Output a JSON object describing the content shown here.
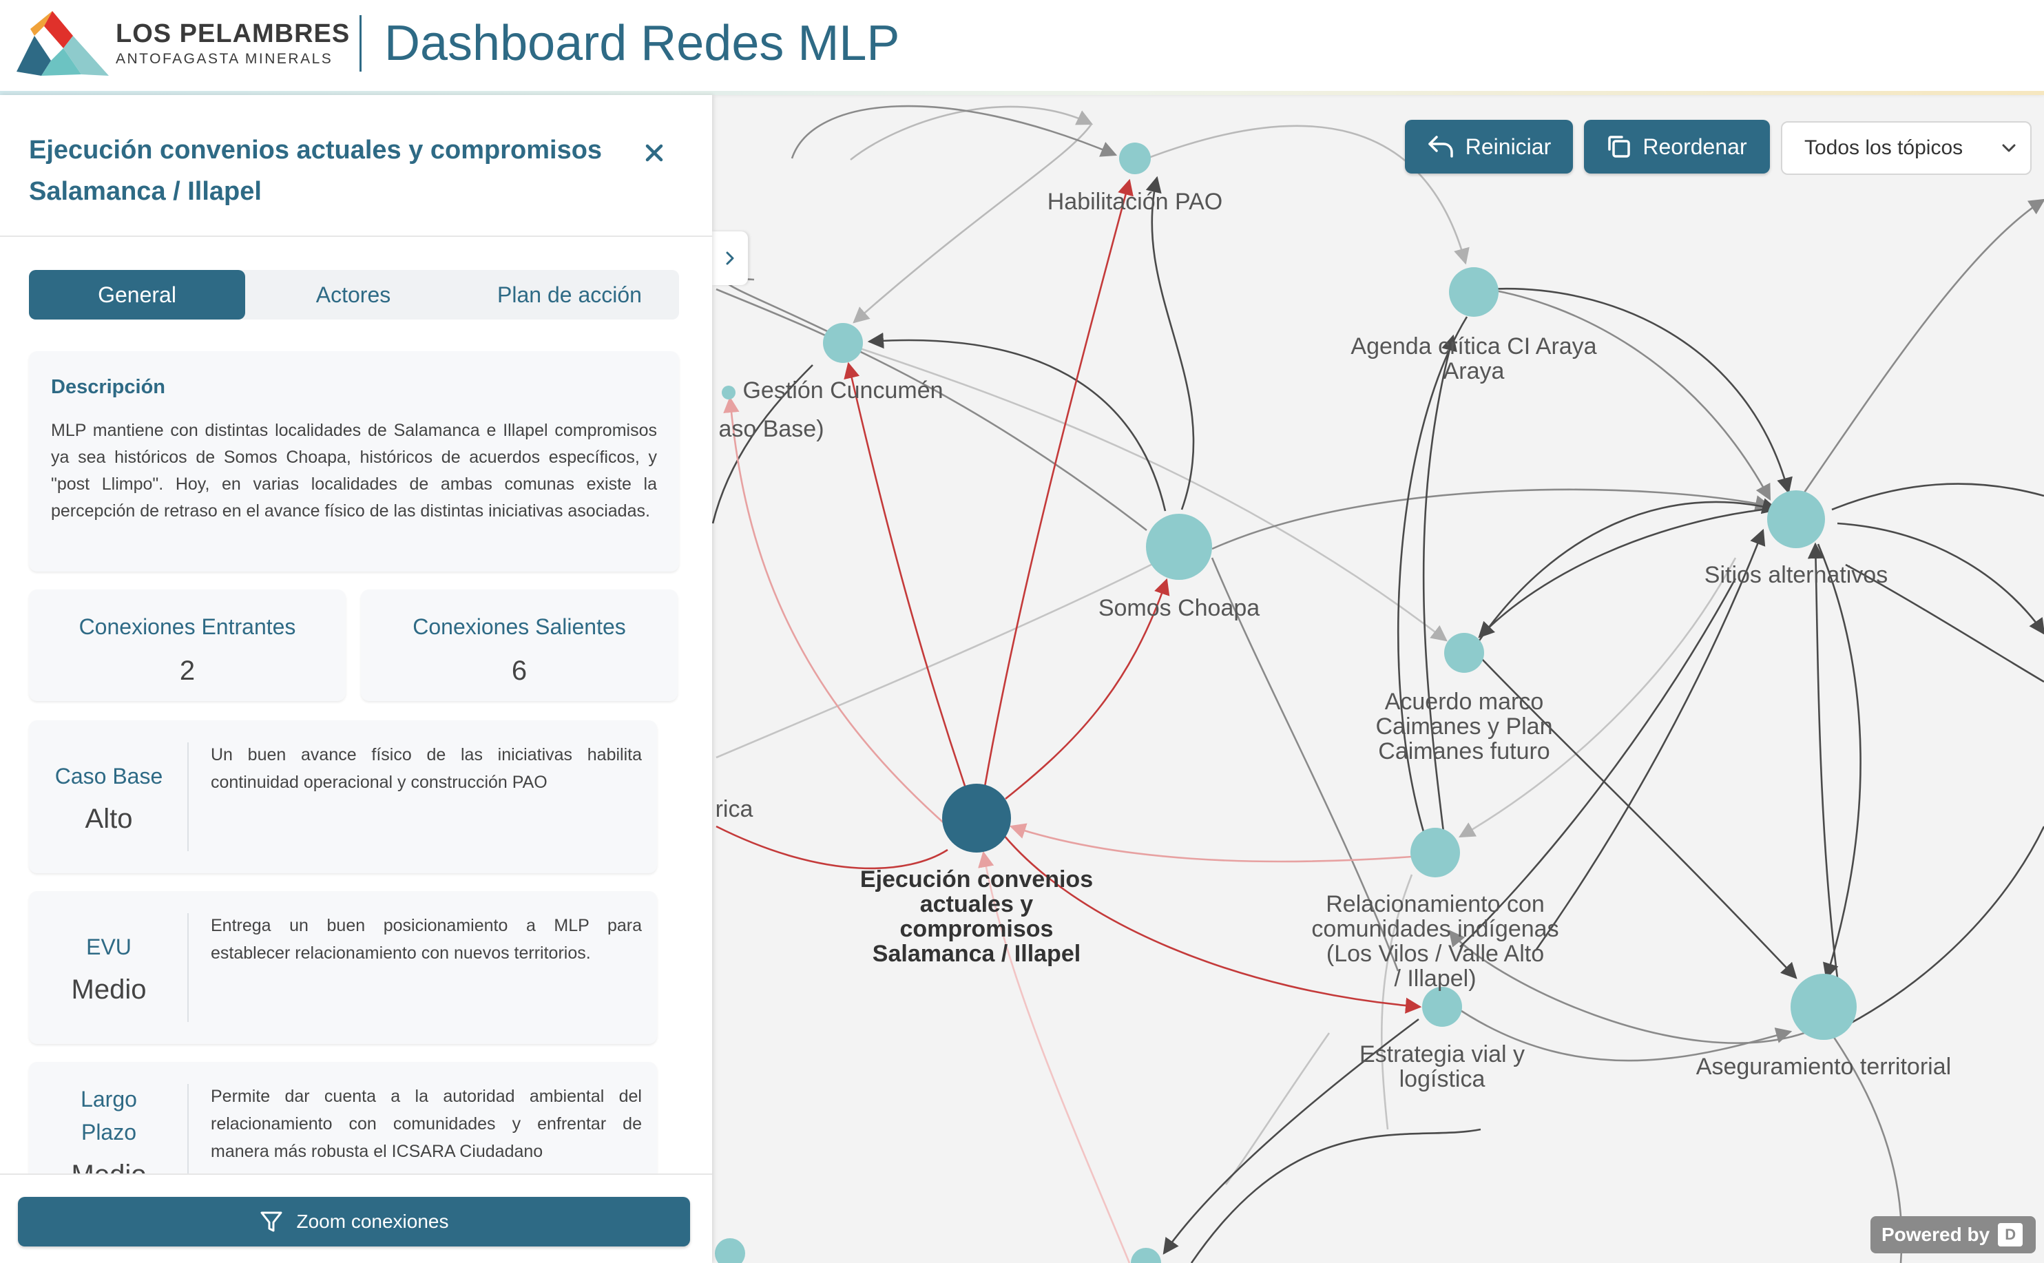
{
  "header": {
    "brand_name": "LOS PELAMBRES",
    "brand_sub": "ANTOFAGASTA MINERALS",
    "app_title": "Dashboard Redes MLP"
  },
  "toolbar": {
    "reset_label": "Reiniciar",
    "reorder_label": "Reordenar",
    "topic_filter": "Todos los tópicos"
  },
  "powered": {
    "label": "Powered by",
    "mark": "D"
  },
  "panel": {
    "title": "Ejecución convenios actuales y compromisos Salamanca / Illapel",
    "tabs": [
      {
        "label": "General",
        "active": true
      },
      {
        "label": "Actores",
        "active": false
      },
      {
        "label": "Plan de acción",
        "active": false
      }
    ],
    "description_heading": "Descripción",
    "description": "MLP mantiene con distintas localidades de Salamanca e Illapel compromisos ya sea históricos de Somos Choapa, históricos de acuerdos específicos, y \"post Llimpo\". Hoy, en varias localidades de ambas comunas existe la percepción de retraso en el avance físico de las distintas iniciativas asociadas.",
    "incoming": {
      "label": "Conexiones Entrantes",
      "value": "2"
    },
    "outgoing": {
      "label": "Conexiones Salientes",
      "value": "6"
    },
    "ratings": [
      {
        "name": "Caso Base",
        "level": "Alto",
        "text": "Un buen avance físico de las iniciativas habilita continuidad operacional y construcción PAO"
      },
      {
        "name": "EVU",
        "level": "Medio",
        "text": "Entrega un buen posicionamiento a MLP para establecer relacionamiento con nuevos territorios."
      },
      {
        "name": "Largo Plazo",
        "level": "Medio",
        "text": "Permite dar cuenta a la autoridad ambiental del relacionamiento con comunidades y enfrentar de manera más robusta el ICSARA Ciudadano"
      }
    ],
    "zoom_label": "Zoom conexiones"
  },
  "graph": {
    "colors": {
      "node": "#8ecbcc",
      "selected": "#2e6a85",
      "edge_dark": "#4a4a4a",
      "edge_light": "#b9b9b9",
      "edge_red": "#c43a3a",
      "edge_pink": "#e7a1a1"
    },
    "nodes": [
      {
        "id": "habilitacion",
        "label": [
          "Habilitación PAO"
        ]
      },
      {
        "id": "gestion",
        "label": [
          "Gestión Cuncumén"
        ]
      },
      {
        "id": "caso",
        "label": [
          "aso Base)"
        ]
      },
      {
        "id": "agenda",
        "label": [
          "Agenda crítica CI Araya",
          "Araya"
        ]
      },
      {
        "id": "somos",
        "label": [
          "Somos Choapa"
        ]
      },
      {
        "id": "sitios",
        "label": [
          "Sitios alternativos"
        ]
      },
      {
        "id": "acuerdo",
        "label": [
          "Acuerdo marco",
          "Caimanes y Plan",
          "Caimanes futuro"
        ]
      },
      {
        "id": "historica",
        "label": [
          "rica"
        ]
      },
      {
        "id": "ejecucion",
        "label": [
          "Ejecución convenios",
          "actuales y",
          "compromisos",
          "Salamanca / Illapel"
        ]
      },
      {
        "id": "relacion",
        "label": [
          "Relacionamiento con",
          "comunidades indígenas",
          "(Los Vilos / Valle Alto",
          "/ Illapel)"
        ]
      },
      {
        "id": "estrategia",
        "label": [
          "Estrategia vial y",
          "logística"
        ]
      },
      {
        "id": "aseguramiento",
        "label": [
          "Aseguramiento territorial"
        ]
      },
      {
        "id": "bottom1",
        "label": []
      },
      {
        "id": "bottom2",
        "label": []
      },
      {
        "id": "small",
        "label": []
      }
    ]
  }
}
